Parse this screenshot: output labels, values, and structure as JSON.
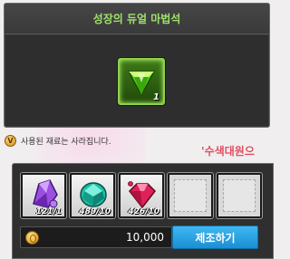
{
  "window": {
    "title": "성장의 듀얼 마법석"
  },
  "result": {
    "item_icon": "green-gem-icon",
    "count": "1"
  },
  "notice": {
    "icon": "alert-coin-icon",
    "text": "사용된 재료는 사라집니다."
  },
  "background": {
    "banner_text": "'수색대원으"
  },
  "materials": [
    {
      "icon": "purple-crystal-icon",
      "count": "121/1"
    },
    {
      "icon": "teal-gem-icon",
      "count": "489/10"
    },
    {
      "icon": "red-gem-icon",
      "count": "426/10"
    },
    {
      "icon": "empty-slot",
      "count": ""
    },
    {
      "icon": "empty-slot",
      "count": ""
    }
  ],
  "price": {
    "currency_icon": "meso-coin-icon",
    "value": "10,000"
  },
  "craft_button": {
    "label": "제조하기"
  },
  "colors": {
    "title_green": "#9de36a",
    "button_blue": "#2aa3e6",
    "result_green": "#8fd04e"
  }
}
